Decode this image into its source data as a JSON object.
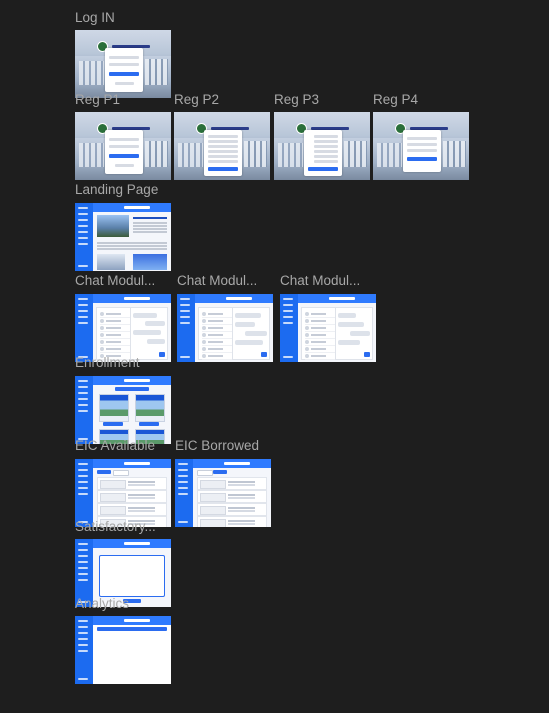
{
  "canvas": {
    "background": "#1e1e1e",
    "label_color": "#a8a8a8",
    "accent": "#2b6cf0"
  },
  "frames": {
    "login": "Log IN",
    "reg_p1": "Reg P1",
    "reg_p2": "Reg P2",
    "reg_p3": "Reg P3",
    "reg_p4": "Reg P4",
    "landing": "Landing Page",
    "chat1": "Chat Modul...",
    "chat2": "Chat Modul...",
    "chat3": "Chat Modul...",
    "enrollment": "Enrollment",
    "eic_available": "EIC Available",
    "eic_borrowed": "EIC Borrowed",
    "satisfactory": "Satisfactory...",
    "analytics": "Analytics"
  }
}
